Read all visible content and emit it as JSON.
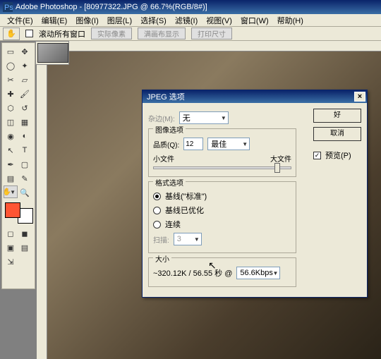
{
  "app": {
    "title": "Adobe Photoshop - [80977322.JPG @ 66.7%(RGB/8#)]"
  },
  "menu": {
    "items": [
      "文件(E)",
      "编辑(E)",
      "图像(I)",
      "图层(L)",
      "选择(S)",
      "滤镜(I)",
      "视图(V)",
      "窗口(W)",
      "帮助(H)"
    ]
  },
  "optbar": {
    "scroll_all": "滚动所有窗口",
    "btn1": "实际像素",
    "btn2": "满画布显示",
    "btn3": "打印尺寸"
  },
  "dlg": {
    "title": "JPEG 选项",
    "matte_lbl": "杂边(M):",
    "matte_val": "无",
    "img_grp": "图像选项",
    "quality_lbl": "品质(Q):",
    "quality_val": "12",
    "quality_preset": "最佳",
    "small": "小文件",
    "large": "大文件",
    "fmt_grp": "格式选项",
    "r1": "基线(\"标准\")",
    "r2": "基线已优化",
    "r3": "连续",
    "scans_lbl": "扫描:",
    "scans_val": "3",
    "size_grp": "大小",
    "size_text": "~320.12K / 56.55 秒  @",
    "bps": "56.6Kbps",
    "ok": "好",
    "cancel": "取消",
    "preview": "预览(P)"
  }
}
